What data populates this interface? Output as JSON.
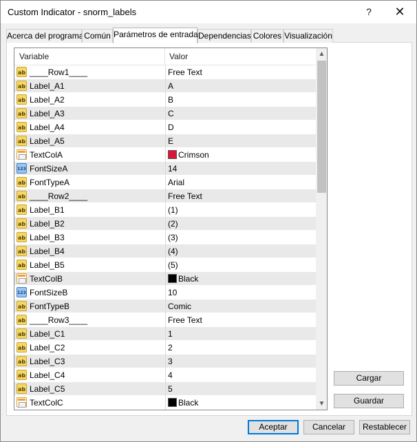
{
  "window": {
    "title": "Custom Indicator - snorm_labels",
    "help_glyph": "?",
    "close_glyph": "✕"
  },
  "tabs": [
    {
      "label": "Acerca del programa"
    },
    {
      "label": "Común"
    },
    {
      "label": "Parámetros de entrada"
    },
    {
      "label": "Dependencias"
    },
    {
      "label": "Colores"
    },
    {
      "label": "Visualización"
    }
  ],
  "active_tab": "Parámetros de entrada",
  "grid": {
    "headers": {
      "variable": "Variable",
      "value": "Valor"
    },
    "rows": [
      {
        "type": "ab",
        "name": "____Row1____",
        "value": "Free Text"
      },
      {
        "type": "ab",
        "name": "Label_A1",
        "value": "A"
      },
      {
        "type": "ab",
        "name": "Label_A2",
        "value": "B"
      },
      {
        "type": "ab",
        "name": "Label_A3",
        "value": "C"
      },
      {
        "type": "ab",
        "name": "Label_A4",
        "value": "D"
      },
      {
        "type": "ab",
        "name": "Label_A5",
        "value": "E"
      },
      {
        "type": "color",
        "name": "TextColA",
        "value": "Crimson",
        "swatch": "#dc143c"
      },
      {
        "type": "num",
        "name": "FontSizeA",
        "value": "14"
      },
      {
        "type": "ab",
        "name": "FontTypeA",
        "value": "Arial"
      },
      {
        "type": "ab",
        "name": "____Row2____",
        "value": "Free Text"
      },
      {
        "type": "ab",
        "name": "Label_B1",
        "value": "(1)"
      },
      {
        "type": "ab",
        "name": "Label_B2",
        "value": "(2)"
      },
      {
        "type": "ab",
        "name": "Label_B3",
        "value": "(3)"
      },
      {
        "type": "ab",
        "name": "Label_B4",
        "value": "(4)"
      },
      {
        "type": "ab",
        "name": "Label_B5",
        "value": "(5)"
      },
      {
        "type": "color",
        "name": "TextColB",
        "value": "Black",
        "swatch": "#000000"
      },
      {
        "type": "num",
        "name": "FontSizeB",
        "value": "10"
      },
      {
        "type": "ab",
        "name": "FontTypeB",
        "value": "Comic"
      },
      {
        "type": "ab",
        "name": "____Row3____",
        "value": "Free Text"
      },
      {
        "type": "ab",
        "name": "Label_C1",
        "value": "1"
      },
      {
        "type": "ab",
        "name": "Label_C2",
        "value": "2"
      },
      {
        "type": "ab",
        "name": "Label_C3",
        "value": "3"
      },
      {
        "type": "ab",
        "name": "Label_C4",
        "value": "4"
      },
      {
        "type": "ab",
        "name": "Label_C5",
        "value": "5"
      },
      {
        "type": "color",
        "name": "TextColC",
        "value": "Black",
        "swatch": "#000000"
      }
    ]
  },
  "icons": {
    "ab": "ab",
    "num": "123",
    "scroll_up": "▲",
    "scroll_down": "▼"
  },
  "buttons": {
    "cargar": "Cargar",
    "guardar": "Guardar",
    "aceptar": "Aceptar",
    "cancelar": "Cancelar",
    "restablecer": "Restablecer"
  }
}
